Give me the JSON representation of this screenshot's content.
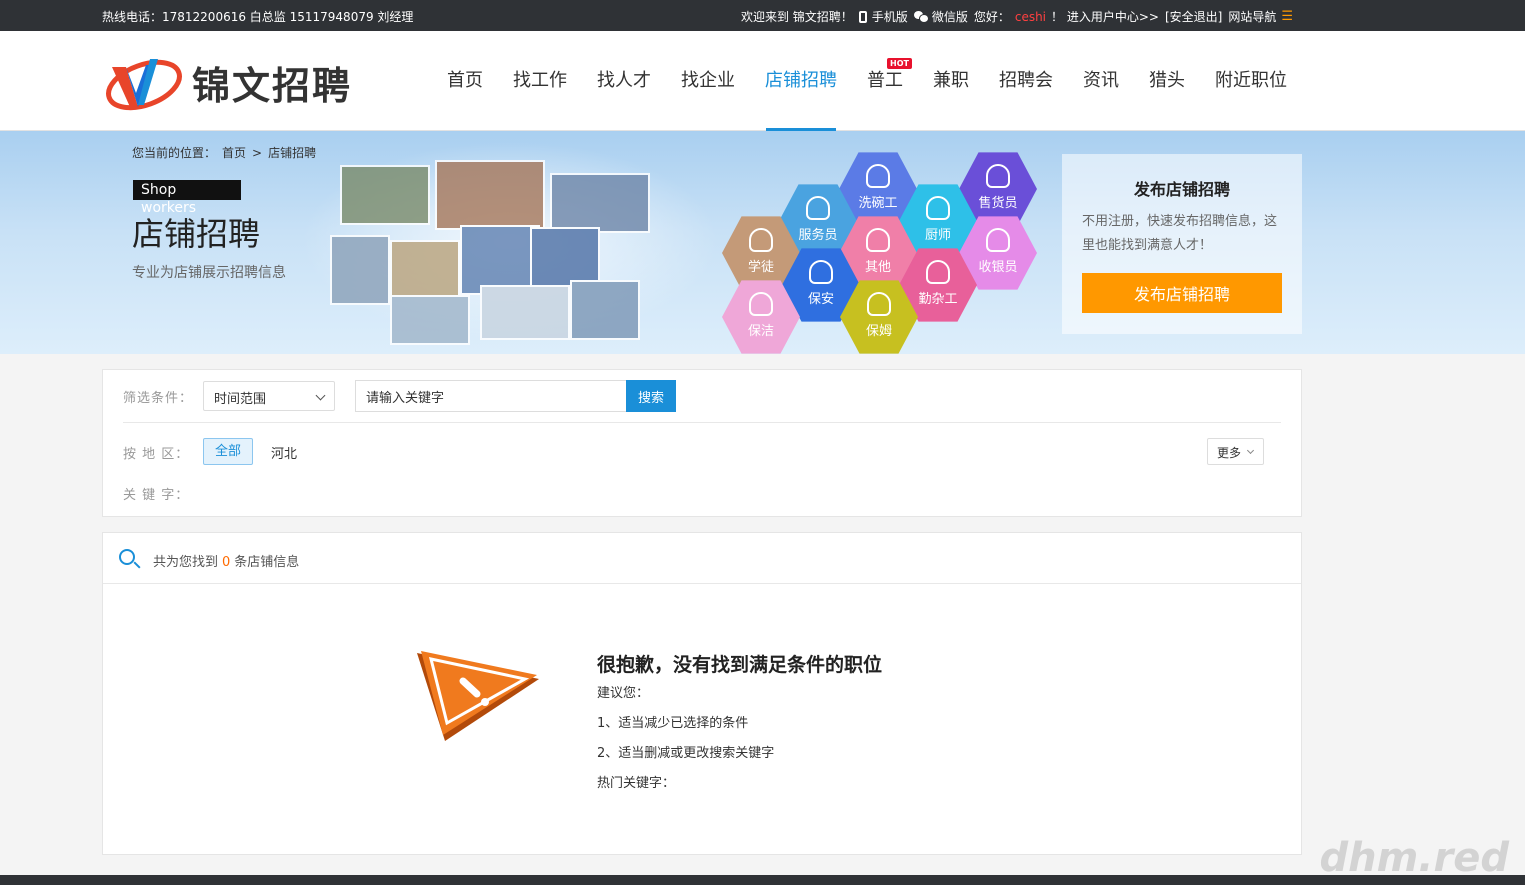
{
  "topbar": {
    "hotline": "热线电话：17812200616 白总监 15117948079 刘经理",
    "welcome": "欢迎来到 锦文招聘！",
    "mobile": "手机版",
    "wechat": "微信版",
    "greeting": "您好：",
    "username": "ceshi",
    "user_center": "！ 进入用户中心>>",
    "logout": "[安全退出]",
    "site_nav": "网站导航",
    "site_nav_icon": "☰"
  },
  "header": {
    "logo_text": "锦文招聘",
    "nav": [
      {
        "label": "首页"
      },
      {
        "label": "找工作"
      },
      {
        "label": "找人才"
      },
      {
        "label": "找企业"
      },
      {
        "label": "店铺招聘"
      },
      {
        "label": "普工",
        "badge": "HOT"
      },
      {
        "label": "兼职"
      },
      {
        "label": "招聘会"
      },
      {
        "label": "资讯"
      },
      {
        "label": "猎头"
      },
      {
        "label": "附近职位"
      }
    ],
    "active_nav": "店铺招聘"
  },
  "banner": {
    "breadcrumb": {
      "prefix": "您当前的位置：",
      "home": "首页",
      "sep": ">",
      "current": "店铺招聘"
    },
    "en_tag": "Shop workers",
    "title": "店铺招聘",
    "subtitle": "专业为店铺展示招聘信息",
    "hexagons": [
      {
        "label": "洗碗工",
        "color": "#5b7be6",
        "icon": "dish-icon"
      },
      {
        "label": "售货员",
        "color": "#6a4fd8",
        "icon": "salesperson-icon"
      },
      {
        "label": "服务员",
        "color": "#4aa3e0",
        "icon": "waiter-icon"
      },
      {
        "label": "厨师",
        "color": "#2ec0e8",
        "icon": "chef-icon"
      },
      {
        "label": "学徒",
        "color": "#c49a78",
        "icon": "apprentice-icon"
      },
      {
        "label": "其他",
        "color": "#f07fa8",
        "icon": "other-icon"
      },
      {
        "label": "收银员",
        "color": "#e58be8",
        "icon": "cashier-icon"
      },
      {
        "label": "保安",
        "color": "#2f6fe0",
        "icon": "guard-icon"
      },
      {
        "label": "勤杂工",
        "color": "#e8609a",
        "icon": "handyman-icon"
      },
      {
        "label": "保洁",
        "color": "#efa7d8",
        "icon": "cleaner-icon"
      },
      {
        "label": "保姆",
        "color": "#c7c020",
        "icon": "nanny-icon"
      }
    ],
    "publish": {
      "title": "发布店铺招聘",
      "desc": "不用注册，快速发布招聘信息，这里也能找到满意人才！",
      "button": "发布店铺招聘"
    }
  },
  "filter": {
    "label_conditions": "筛选条件：",
    "time_select": "时间范围",
    "keyword_placeholder": "请输入关键字",
    "search_button": "搜索",
    "label_area": "按 地 区：",
    "area_all": "全部",
    "area_hebei": "河北",
    "more": "更多",
    "label_keyword": "关 键 字："
  },
  "results": {
    "prefix": "共为您找到",
    "count": "0",
    "suffix": "条店铺信息",
    "empty_title": "很抱歉，没有找到满足条件的职位",
    "suggest": "建议您：",
    "tip1": "1、适当减少已选择的条件",
    "tip2": "2、适当删减或更改搜索关键字",
    "hot_keywords": "热门关键字："
  },
  "watermark": "dhm.red",
  "colors": {
    "accent": "#1a8fd8",
    "orange": "#ff9800",
    "topbar": "#2f3236"
  }
}
